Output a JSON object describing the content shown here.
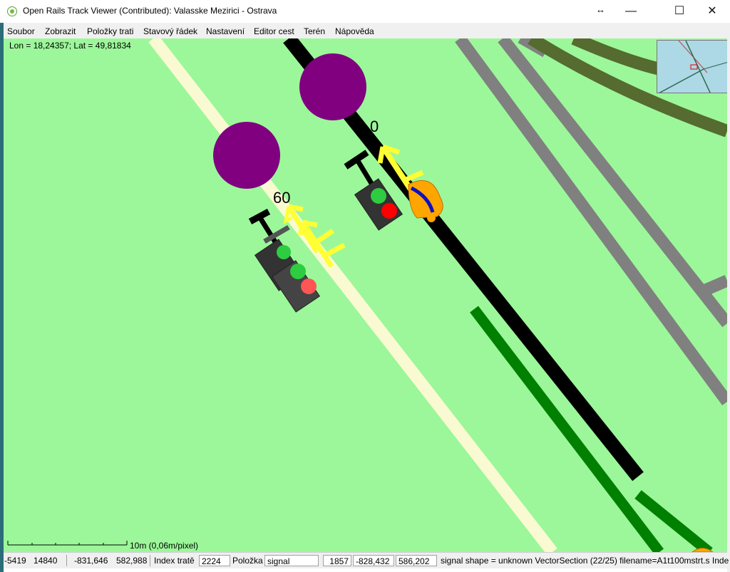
{
  "window": {
    "title": "Open Rails Track Viewer (Contributed): Valasske Mezirici - Ostrava",
    "resize_glyph": "↔",
    "minimize": "—",
    "maximize": "☐",
    "close": "✕"
  },
  "menu": [
    "Soubor",
    "Zobrazit",
    "Položky trati",
    "Stavový řádek",
    "Nastavení",
    "Editor cest",
    "Terén",
    "Nápověda"
  ],
  "map": {
    "coords": "Lon = 18,24357; Lat = 49,81834",
    "speed_label_1": "60",
    "speed_label_2": "0",
    "scale_label": "10m (0,06m/pixel)",
    "colors": {
      "background": "#9cf79a",
      "road": "#808080",
      "track": "#000000",
      "track_dark": "#556b2f",
      "path": "#fafad2",
      "platform": "#800080",
      "siding": "#008000",
      "inset_water": "#add8e6"
    },
    "icons": [
      "signal-icon",
      "speedpost-arrow-icon",
      "bell-icon"
    ]
  },
  "status": {
    "x": "-5419",
    "z": "14840",
    "tile_x": "-831,646",
    "tile_z": "582,988",
    "track_index_label": "Index tratě",
    "track_index": "2224",
    "item_label": "Položka",
    "item_value": "signal",
    "item_index": "1857",
    "item_x": "-828,432",
    "item_z": "586,202",
    "description": "signal shape = unknown VectorSection (22/25) filename=A1t100mstrt.s Inde"
  }
}
